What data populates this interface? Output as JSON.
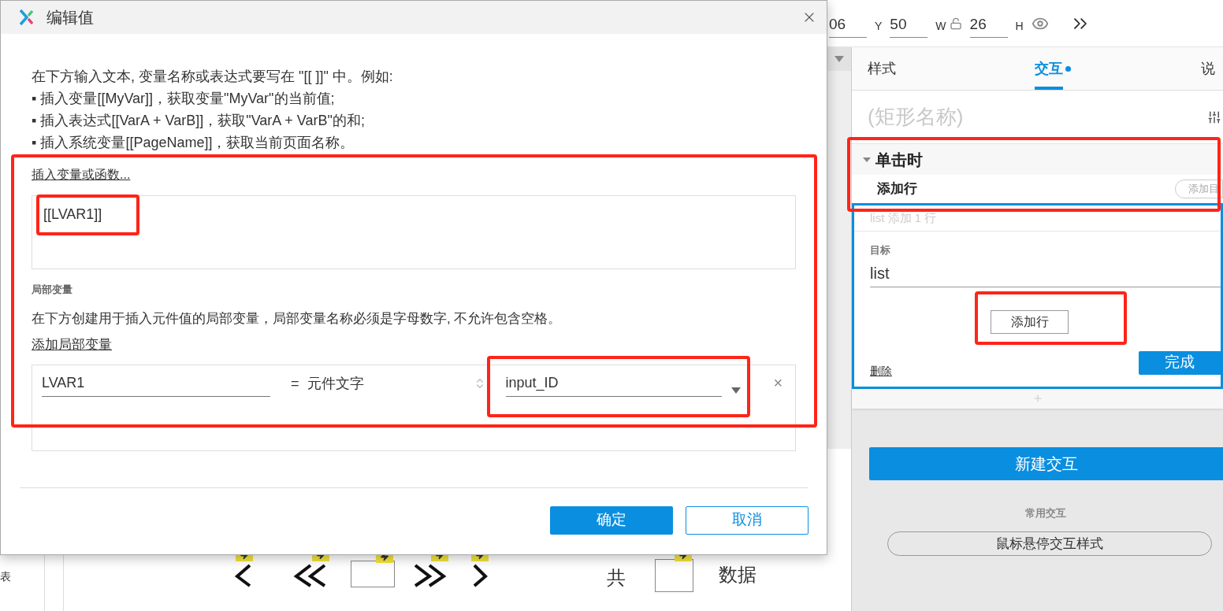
{
  "dialog": {
    "title": "编辑值",
    "intro": [
      "在下方输入文本, 变量名称或表达式要写在 \"[[ ]]\" 中。例如:",
      "▪ 插入变量[[MyVar]]，获取变量\"MyVar\"的当前值;",
      "▪ 插入表达式[[VarA + VarB]]，获取\"VarA + VarB\"的和;",
      "▪ 插入系统变量[[PageName]]，获取当前页面名称。"
    ],
    "insert_link": "插入变量或函数...",
    "value": "[[LVAR1]]",
    "local_vars_heading": "局部变量",
    "local_vars_description": "在下方创建用于插入元件值的局部变量，局部变量名称必须是字母数字, 不允许包含空格。",
    "add_local_var_link": "添加局部变量",
    "local_vars": [
      {
        "name": "LVAR1",
        "equals": "=",
        "type": "元件文字",
        "target": "input_ID",
        "remove": "×"
      }
    ],
    "buttons": [
      {
        "label": "确定",
        "kind": "primary"
      },
      {
        "label": "取消",
        "kind": "secondary"
      }
    ]
  },
  "toolbar": {
    "fields": [
      {
        "value": "06"
      },
      {
        "label": "Y",
        "value": "50"
      },
      {
        "label": "W",
        "value": "26"
      }
    ],
    "trailing_label": "H"
  },
  "panel": {
    "tabs": [
      {
        "label": "样式",
        "selected": false
      },
      {
        "label": "交互",
        "selected": true
      },
      {
        "label": "说",
        "selected": false
      }
    ],
    "name_placeholder": "(矩形名称)",
    "event": {
      "title": "单击时",
      "expanded": true
    },
    "action": {
      "title": "添加行",
      "add_target_button": "添加目",
      "summary": "list 添加 1 行",
      "target_label": "目标",
      "target_value": "list",
      "add_row_button": "添加行",
      "delete_link": "删除",
      "done_button": "完成"
    },
    "new_interaction_button": "新建交互",
    "common_heading": "常用交互",
    "hover_style_button": "鼠标悬停交互样式"
  },
  "canvas": {
    "side_label": "表",
    "items": [
      {
        "kind": "prev"
      },
      {
        "kind": "first"
      },
      {
        "kind": "page_box"
      },
      {
        "kind": "last"
      },
      {
        "kind": "next"
      },
      {
        "kind": "label",
        "text": "共"
      },
      {
        "kind": "page_box"
      },
      {
        "kind": "label",
        "text": "数据"
      }
    ]
  }
}
